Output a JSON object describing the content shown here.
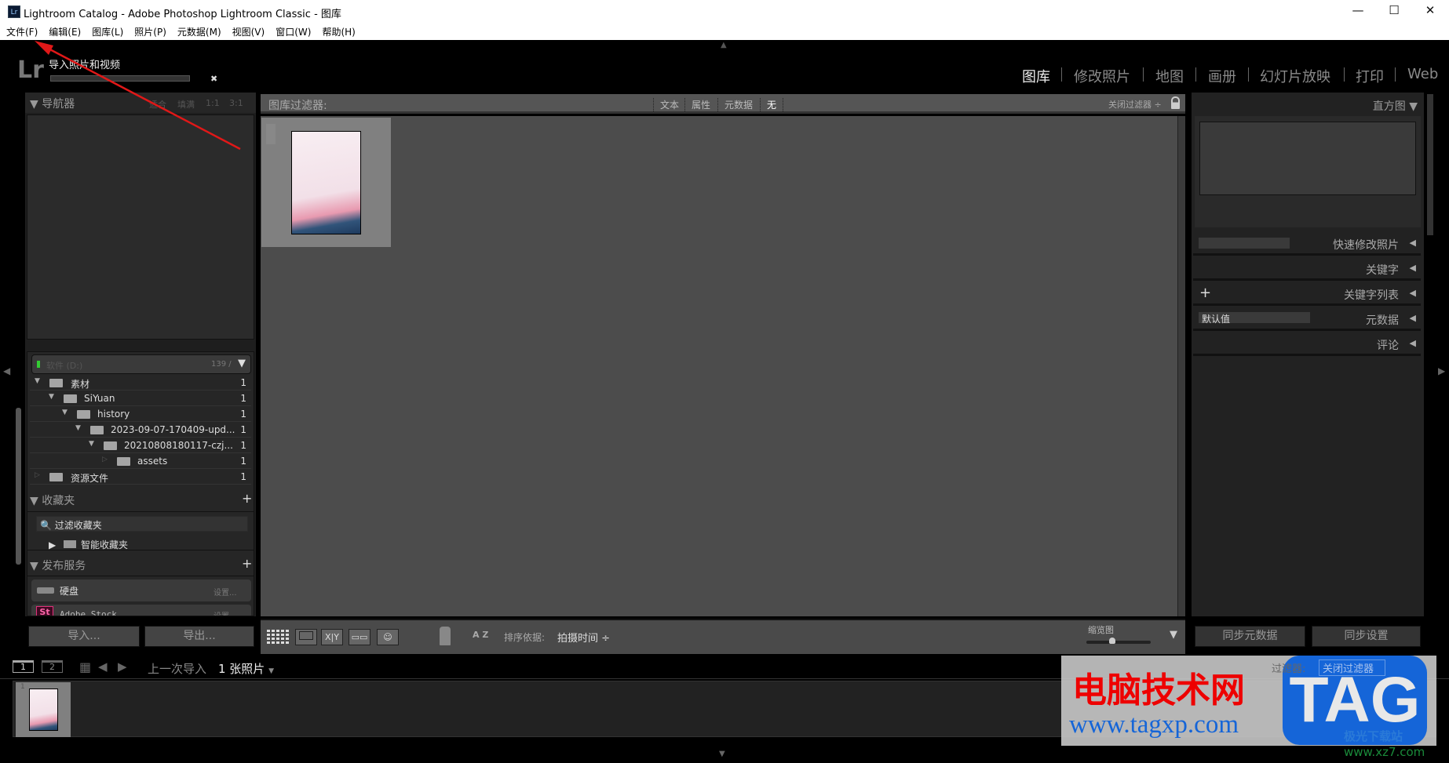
{
  "window": {
    "title": "Lightroom Catalog - Adobe Photoshop Lightroom Classic - 图库",
    "app_icon": "Lr",
    "controls": {
      "minimize": "—",
      "maximize": "☐",
      "close": "✕"
    }
  },
  "menu": [
    "文件(F)",
    "编辑(E)",
    "图库(L)",
    "照片(P)",
    "元数据(M)",
    "视图(V)",
    "窗口(W)",
    "帮助(H)"
  ],
  "identity": {
    "logo": "Lr",
    "task": "导入照片和视频",
    "progress_close": "✖"
  },
  "modules": [
    "图库",
    "修改照片",
    "地图",
    "画册",
    "幻灯片放映",
    "打印",
    "Web"
  ],
  "active_module": "图库",
  "navigator": {
    "title": "导航器",
    "zoom_options": [
      "适合",
      "填满",
      "1:1",
      "3:1"
    ]
  },
  "folders": {
    "drive": "软件 (D:)",
    "drive_info": "139 /",
    "items": [
      {
        "name": "素材",
        "count": "1"
      },
      {
        "name": "SiYuan",
        "count": "1"
      },
      {
        "name": "history",
        "count": "1"
      },
      {
        "name": "2023-09-07-170409-upd...",
        "count": "1"
      },
      {
        "name": "20210808180117-czj...",
        "count": "1"
      },
      {
        "name": "assets",
        "count": "1"
      },
      {
        "name": "资源文件",
        "count": "1"
      }
    ]
  },
  "collections": {
    "title": "收藏夹",
    "filter_placeholder": "过滤收藏夹",
    "smart": "智能收藏夹",
    "add": "+"
  },
  "publish": {
    "title": "发布服务",
    "add": "+",
    "services": [
      {
        "name": "硬盘",
        "action": "设置..."
      },
      {
        "name": "Adobe Stock",
        "action": "设置..."
      }
    ]
  },
  "left_buttons": {
    "import": "导入...",
    "export": "导出..."
  },
  "filter_bar": {
    "label": "图库过滤器:",
    "options": [
      "文本",
      "属性",
      "元数据",
      "无"
    ],
    "active": "无",
    "preset": "关闭过滤器 ÷"
  },
  "grid": {
    "thumbnails": [
      {
        "index": "1"
      }
    ]
  },
  "toolbar": {
    "sort_label": "排序依据:",
    "sort_value": "拍摄时间",
    "thumb_label": "缩览图",
    "thumb_size": 0.4,
    "xy": "X|Y",
    "az": "A Z"
  },
  "right_panel": {
    "histogram": "直方图",
    "sections": [
      "快速修改照片",
      "关键字",
      "关键字列表",
      "元数据",
      "评论"
    ],
    "metadata_preset": "默认值",
    "keyword_add": "+"
  },
  "right_buttons": {
    "sync_metadata": "同步元数据",
    "sync_settings": "同步设置"
  },
  "filmstrip": {
    "screen1": "1",
    "screen2": "2",
    "source": "上一次导入",
    "count": "1 张照片",
    "filter_label": "过滤器:",
    "filter_value": "关闭过滤器",
    "thumb_index": "1"
  },
  "watermark": {
    "site": "电脑技术网",
    "url": "www.tagxp.com",
    "badge": "TAG",
    "sub": "极光下载站",
    "sub_url": "www.xz7.com"
  },
  "colors": {
    "accent_red": "#e02020",
    "panel": "#262626",
    "grid_bg": "#4c4c4c",
    "watermark_blue": "#1565d8"
  }
}
